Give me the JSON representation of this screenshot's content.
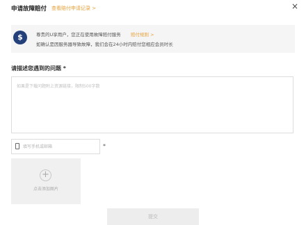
{
  "header": {
    "title": "申请故障赔付",
    "history_link": "查看赔付申请记录 >",
    "close_symbol": "×"
  },
  "notice": {
    "icon_symbol": "$",
    "line1": "尊贵的U享用户，您正在使用故障赔付服务",
    "rules_link": "赔付规则 >",
    "line2": "如确认是因服务器导致故障，我们会在24小时内赔付您相应会员时长"
  },
  "form": {
    "description_label": "请描述您遇到的问题 *",
    "description_placeholder": "如果是下载问题附上资源链接，限制500字数",
    "contact_placeholder": "填写手机或邮箱",
    "required_mark": "*",
    "upload_symbol": "+",
    "upload_label": "点击添加图片",
    "submit_label": "提交"
  },
  "colors": {
    "accent": "#e6a23c",
    "icon_bg": "#23407a"
  }
}
